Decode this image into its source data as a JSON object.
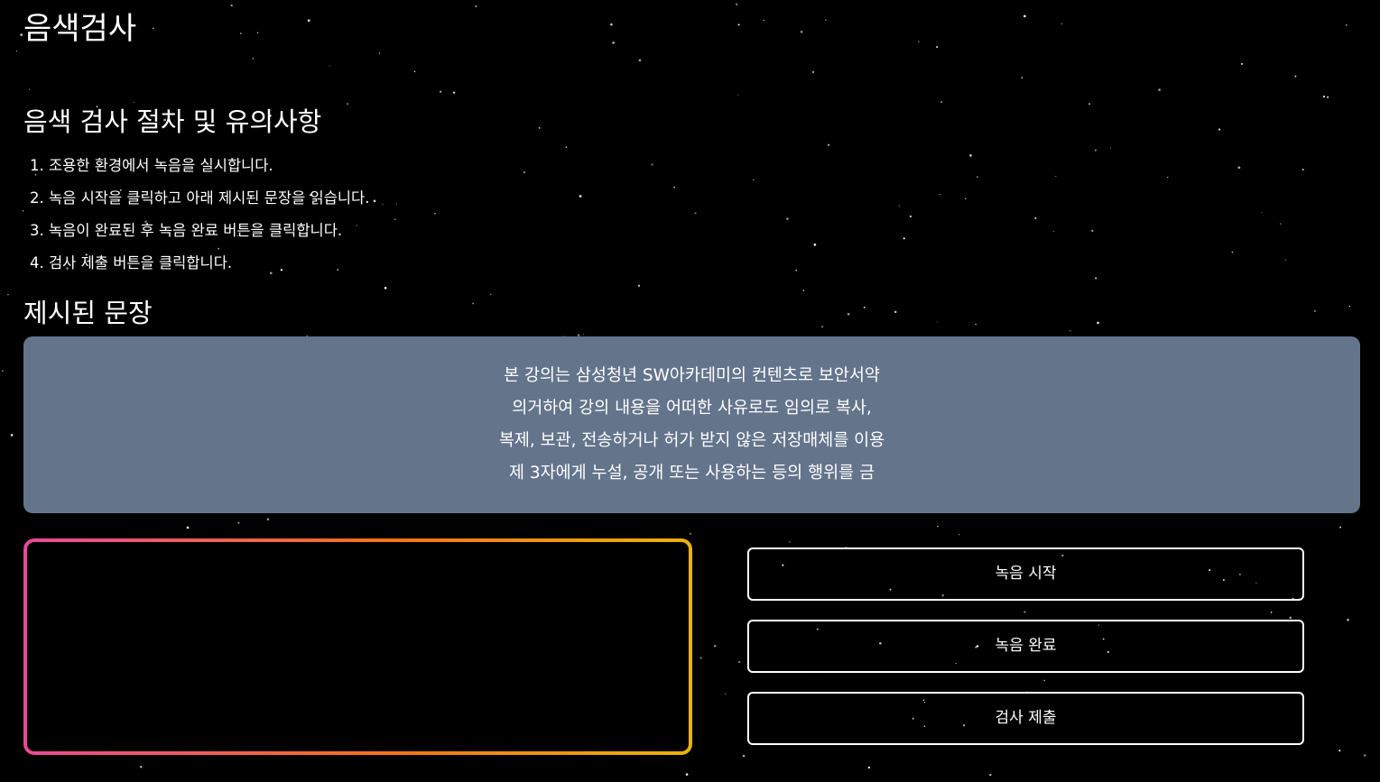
{
  "app": {
    "title": "음색검사"
  },
  "procedure": {
    "heading": "음색 검사 절차 및 유의사항",
    "steps": [
      "1. 조용한 환경에서 녹음을 실시합니다.",
      "2. 녹음 시작을 클릭하고 아래 제시된 문장을 읽습니다.",
      "3. 녹음이 완료된 후 녹음 완료 버튼을 클릭합니다.",
      "4. 검사 제출 버튼을 클릭합니다."
    ]
  },
  "sentence": {
    "heading": "제시된 문장",
    "lines": [
      "본 강의는 삼성청년 SW아카데미의 컨텐츠로 보안서약",
      "의거하여 강의 내용을 어떠한 사유로도 임의로 복사,",
      "복제, 보관, 전송하거나 허가 받지 않은 저장매체를 이용",
      "제 3자에게 누설, 공개 또는 사용하는 등의 행위를 금"
    ]
  },
  "controls": {
    "start_label": "녹음 시작",
    "stop_label": "녹음 완료",
    "submit_label": "검사 제출"
  },
  "colors": {
    "background": "#000000",
    "sentence_box": "#64748b",
    "frame_gradient_start": "#ec4899",
    "frame_gradient_end": "#eab308",
    "text": "#ffffff"
  }
}
